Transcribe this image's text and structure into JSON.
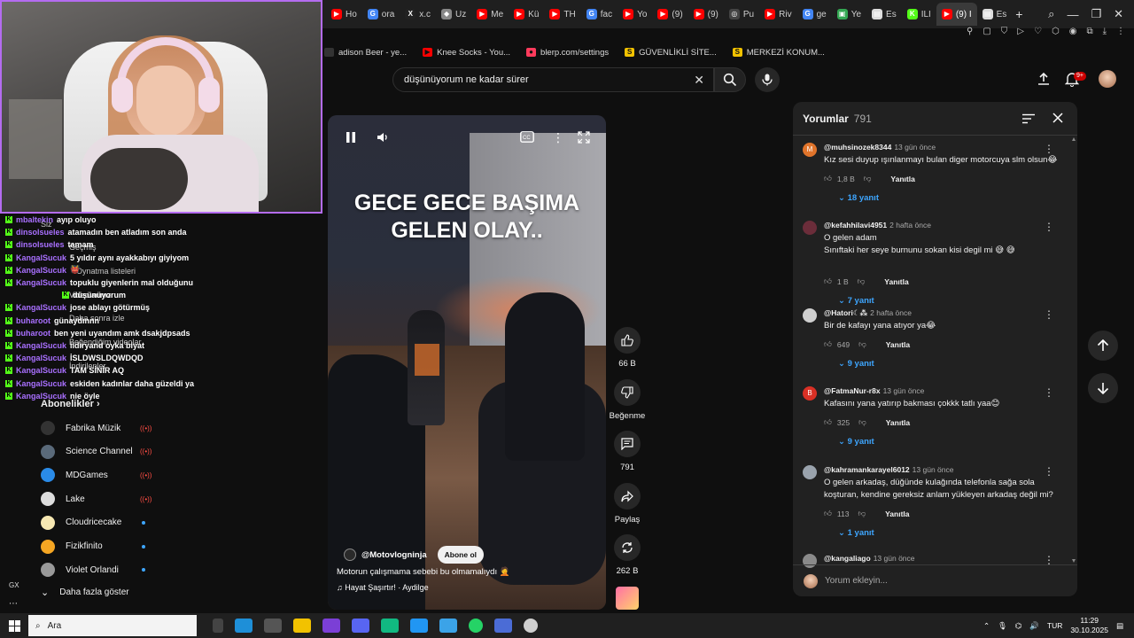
{
  "tabs": [
    {
      "label": "Ho",
      "color": "#ff0000",
      "glyph": "▶"
    },
    {
      "label": "ora",
      "color": "#4285f4",
      "glyph": "G"
    },
    {
      "label": "x.c",
      "color": "#222222",
      "glyph": "X"
    },
    {
      "label": "Uz",
      "color": "#888888",
      "glyph": "◆"
    },
    {
      "label": "Me",
      "color": "#ff0000",
      "glyph": "▶"
    },
    {
      "label": "Kü",
      "color": "#ff0000",
      "glyph": "▶"
    },
    {
      "label": "TH",
      "color": "#ff0000",
      "glyph": "▶"
    },
    {
      "label": "fac",
      "color": "#4285f4",
      "glyph": "G"
    },
    {
      "label": "Yo",
      "color": "#ff0000",
      "glyph": "▶"
    },
    {
      "label": "(9)",
      "color": "#ff0000",
      "glyph": "▶"
    },
    {
      "label": "(9)",
      "color": "#ff0000",
      "glyph": "▶"
    },
    {
      "label": "Pu",
      "color": "#444444",
      "glyph": "◎"
    },
    {
      "label": "Riv",
      "color": "#ff0000",
      "glyph": "▶"
    },
    {
      "label": "ge",
      "color": "#4285f4",
      "glyph": "G"
    },
    {
      "label": "Ye",
      "color": "#34a853",
      "glyph": "▣"
    },
    {
      "label": "Es",
      "color": "#dddddd",
      "glyph": "▤"
    },
    {
      "label": "ILI",
      "color": "#53fc18",
      "glyph": "K"
    },
    {
      "label": "(9) I",
      "color": "#ff0000",
      "glyph": "▶",
      "active": true
    },
    {
      "label": "Es",
      "color": "#dddddd",
      "glyph": "▤"
    }
  ],
  "bookmarks": [
    {
      "label": "adison Beer - ye...",
      "color": "#333333",
      "glyph": ""
    },
    {
      "label": "Knee Socks - You...",
      "color": "#ff0000",
      "glyph": "▶"
    },
    {
      "label": "blerp.com/settings",
      "color": "#ff3b5c",
      "glyph": "●"
    },
    {
      "label": "GÜVENLİKLİ SİTE...",
      "color": "#f2c200",
      "glyph": "S"
    },
    {
      "label": "MERKEZİ KONUM...",
      "color": "#f2c200",
      "glyph": "S"
    }
  ],
  "search": {
    "value": "düşünüyorum ne kadar sürer"
  },
  "notifications": {
    "badge": "9+"
  },
  "chat": [
    {
      "user": "mbaltekin",
      "message": "ayıp oluyo"
    },
    {
      "user": "dinsolsueles",
      "message": "atamadın ben atladım son anda"
    },
    {
      "user": "dinsolsueles",
      "message": "tamam"
    },
    {
      "user": "KangalSucuk",
      "message": "5 yıldır aynı ayakkabıyı giyiyom"
    },
    {
      "user": "KangalSucuk",
      "message": "👹"
    },
    {
      "user": "KangalSucuk",
      "message": "topuklu giyenlerin mal olduğunu"
    },
    {
      "user": "",
      "message": "düşünüyorum"
    },
    {
      "user": "KangalSucuk",
      "message": "jose ablayı götürmüş"
    },
    {
      "user": "buharoot",
      "message": "günaydınnn"
    },
    {
      "user": "buharoot",
      "message": "ben yeni uyandım amk dsakjdpsads"
    },
    {
      "user": "KangalSucuk",
      "message": "iidiryand oyka biyat"
    },
    {
      "user": "KangalSucuk",
      "message": "İSLDWSLDQWDQD"
    },
    {
      "user": "KangalSucuk",
      "message": "TAM SİNİR AQ"
    },
    {
      "user": "KangalSucuk",
      "message": "eskiden kadınlar daha güzeldi ya"
    },
    {
      "user": "KangalSucuk",
      "message": "nie öyle"
    }
  ],
  "sidebar": {
    "ghost": [
      "Siz",
      "Geçmiş",
      "Oynatma listeleri",
      "Videolarınız",
      "Daha sonra izle",
      "Beğendiğim videolar",
      "İndirilenler"
    ],
    "subs_title": "Abonelikler",
    "subs": [
      {
        "name": "Fabrika Müzik",
        "status": "live",
        "color": "#333333"
      },
      {
        "name": "Science Channel",
        "status": "live",
        "color": "#5a6a7a"
      },
      {
        "name": "MDGames",
        "status": "live",
        "color": "#2a8be8"
      },
      {
        "name": "Lake",
        "status": "live",
        "color": "#dddddd"
      },
      {
        "name": "Cloudricecake",
        "status": "new",
        "color": "#f7e8b2"
      },
      {
        "name": "Fizikfinito",
        "status": "new",
        "color": "#f5a623"
      },
      {
        "name": "Violet Orlandi",
        "status": "new",
        "color": "#999999"
      }
    ],
    "show_more": "Daha fazla göster",
    "gx": "GX"
  },
  "video": {
    "title_line1": "GECE GECE BAŞIMA",
    "title_line2": "GELEN OLAY..",
    "channel": "@Motovlogninja",
    "subscribe": "Abone ol",
    "description": "Motorun çalışmama sebebi bu olmamalıydı 🤦",
    "music": "Hayat Şaşırtır! · Aydilge"
  },
  "actions": {
    "likes": "66 B",
    "dislike": "Beğenme",
    "comments": "791",
    "share": "Paylaş",
    "remix": "262 B"
  },
  "comments": {
    "title": "Yorumlar",
    "count": "791",
    "items": [
      {
        "user": "@muhsinozek8344",
        "age": "13 gün önce",
        "text": "Kız sesi duyup ışınlanmayı bulan diger motorcuya slm olsun😂",
        "likes": "1,8 B",
        "reply": "Yanıtla",
        "replies": "18 yanıt",
        "avatar_letter": "M",
        "avatar_color": "#e0742b"
      },
      {
        "user": "@kefahhilavi4951",
        "age": "2 hafta önce",
        "text": "O gelen adam\nSınıftaki her seye burnunu sokan kisi degil mi 😅 😅",
        "likes": "1 B",
        "reply": "Yanıtla",
        "replies": "7 yanıt",
        "avatar_letter": "",
        "avatar_color": "#6b2d3a"
      },
      {
        "user": "@Hatori☾⁂",
        "age": "2 hafta önce",
        "text": "Bir de kafayı yana atıyor ya😂",
        "likes": "649",
        "reply": "Yanıtla",
        "replies": "9 yanıt",
        "avatar_letter": "",
        "avatar_color": "#cfcfcf"
      },
      {
        "user": "@FatmaNur-r8x",
        "age": "13 gün önce",
        "text": "Kafasını yana yatırıp bakması çokkk tatlı yaa😊",
        "likes": "325",
        "reply": "Yanıtla",
        "replies": "9 yanıt",
        "avatar_letter": "B",
        "avatar_color": "#d93025"
      },
      {
        "user": "@kahramankarayel6012",
        "age": "13 gün önce",
        "text": "O gelen arkadaş, düğünde kulağında telefonla sağa sola koşturan, kendine gereksiz anlam yükleyen arkadaş değil mi?",
        "likes": "113",
        "reply": "Yanıtla",
        "replies": "1 yanıt",
        "avatar_letter": "",
        "avatar_color": "#9aa3ad"
      },
      {
        "user": "@kangaliago",
        "age": "13 gün önce",
        "text": "",
        "likes": "",
        "reply": "",
        "replies": "",
        "avatar_letter": "",
        "avatar_color": "#8a8a8a"
      }
    ],
    "input_placeholder": "Yorum ekleyin..."
  },
  "taskbar": {
    "search": "Ara",
    "lang": "TUR",
    "time": "11:29",
    "date": "30.10.2025"
  }
}
